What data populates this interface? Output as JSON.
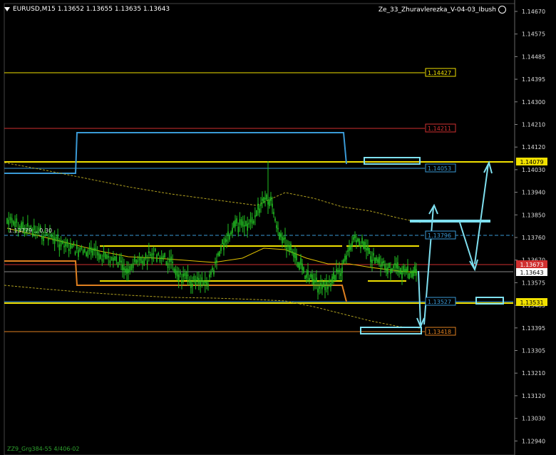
{
  "header": {
    "symbol_info": "EURUSD,M15  1.13652 1.13655 1.13635 1.13643",
    "indicator": "Ze_33_Zhuravlerezka_V-04-03_Ibush"
  },
  "footer": {
    "text": "ZZ9_Grg384-55 4/406-02"
  },
  "overlay": {
    "label": "1.13779 ...0.30"
  },
  "axis": {
    "ticks": [
      "1.14670",
      "1.14575",
      "1.14485",
      "1.14395",
      "1.14300",
      "1.14210",
      "1.14120",
      "1.14030",
      "1.13940",
      "1.13850",
      "1.13760",
      "1.13670",
      "1.13575",
      "1.13485",
      "1.13395",
      "1.13305",
      "1.13210",
      "1.13120",
      "1.13030",
      "1.12940"
    ]
  },
  "price_labels": {
    "current": "1.13643",
    "box_right_upper": "1.14079",
    "box_right_lower": "1.13531",
    "red_right": "1.13673"
  },
  "levels": [
    {
      "label": "1.14427",
      "color": "#f0e000"
    },
    {
      "label": "1.14211",
      "color": "#d03030"
    },
    {
      "label": "1.14053",
      "color": "#3a9ad6"
    },
    {
      "label": "1.13796",
      "color": "#3a9ad6"
    },
    {
      "label": "1.13527",
      "color": "#3a9ad6"
    },
    {
      "label": "1.13418",
      "color": "#e08020"
    }
  ],
  "colors": {
    "candle": "#22c022",
    "arrow": "#7fe0f0",
    "level_yellow": "#f0e000",
    "level_red": "#d03030",
    "level_blue": "#3a9ad6",
    "level_orange": "#e08020"
  }
}
